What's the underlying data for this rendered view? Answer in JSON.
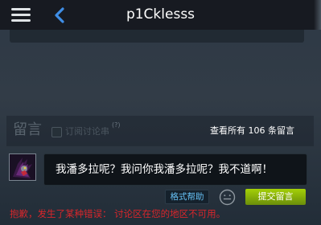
{
  "header": {
    "title": "p1Cklesss",
    "menu_icon": "hamburger-menu-icon",
    "back_icon": "chevron-left-icon"
  },
  "comments": {
    "label": "留言",
    "subscribe_label": "订阅讨论串",
    "subscribe_help": "(?)",
    "subscribe_checked": false,
    "view_all": "查看所有 106 条留言",
    "input_value": "我潘多拉呢？我问你我潘多拉呢？我不道啊！",
    "format_help": "格式帮助",
    "emoticon_icon": "smiley-icon",
    "submit_label": "提交留言",
    "error": "抱歉，发生了某种错误： 讨论区在您的地区不可用。"
  },
  "colors": {
    "topbar": "#171a21",
    "background": "#2f3a46",
    "accent_blue": "#66c0f4",
    "submit_green": "#a4d007",
    "error_red": "#d8262b"
  }
}
